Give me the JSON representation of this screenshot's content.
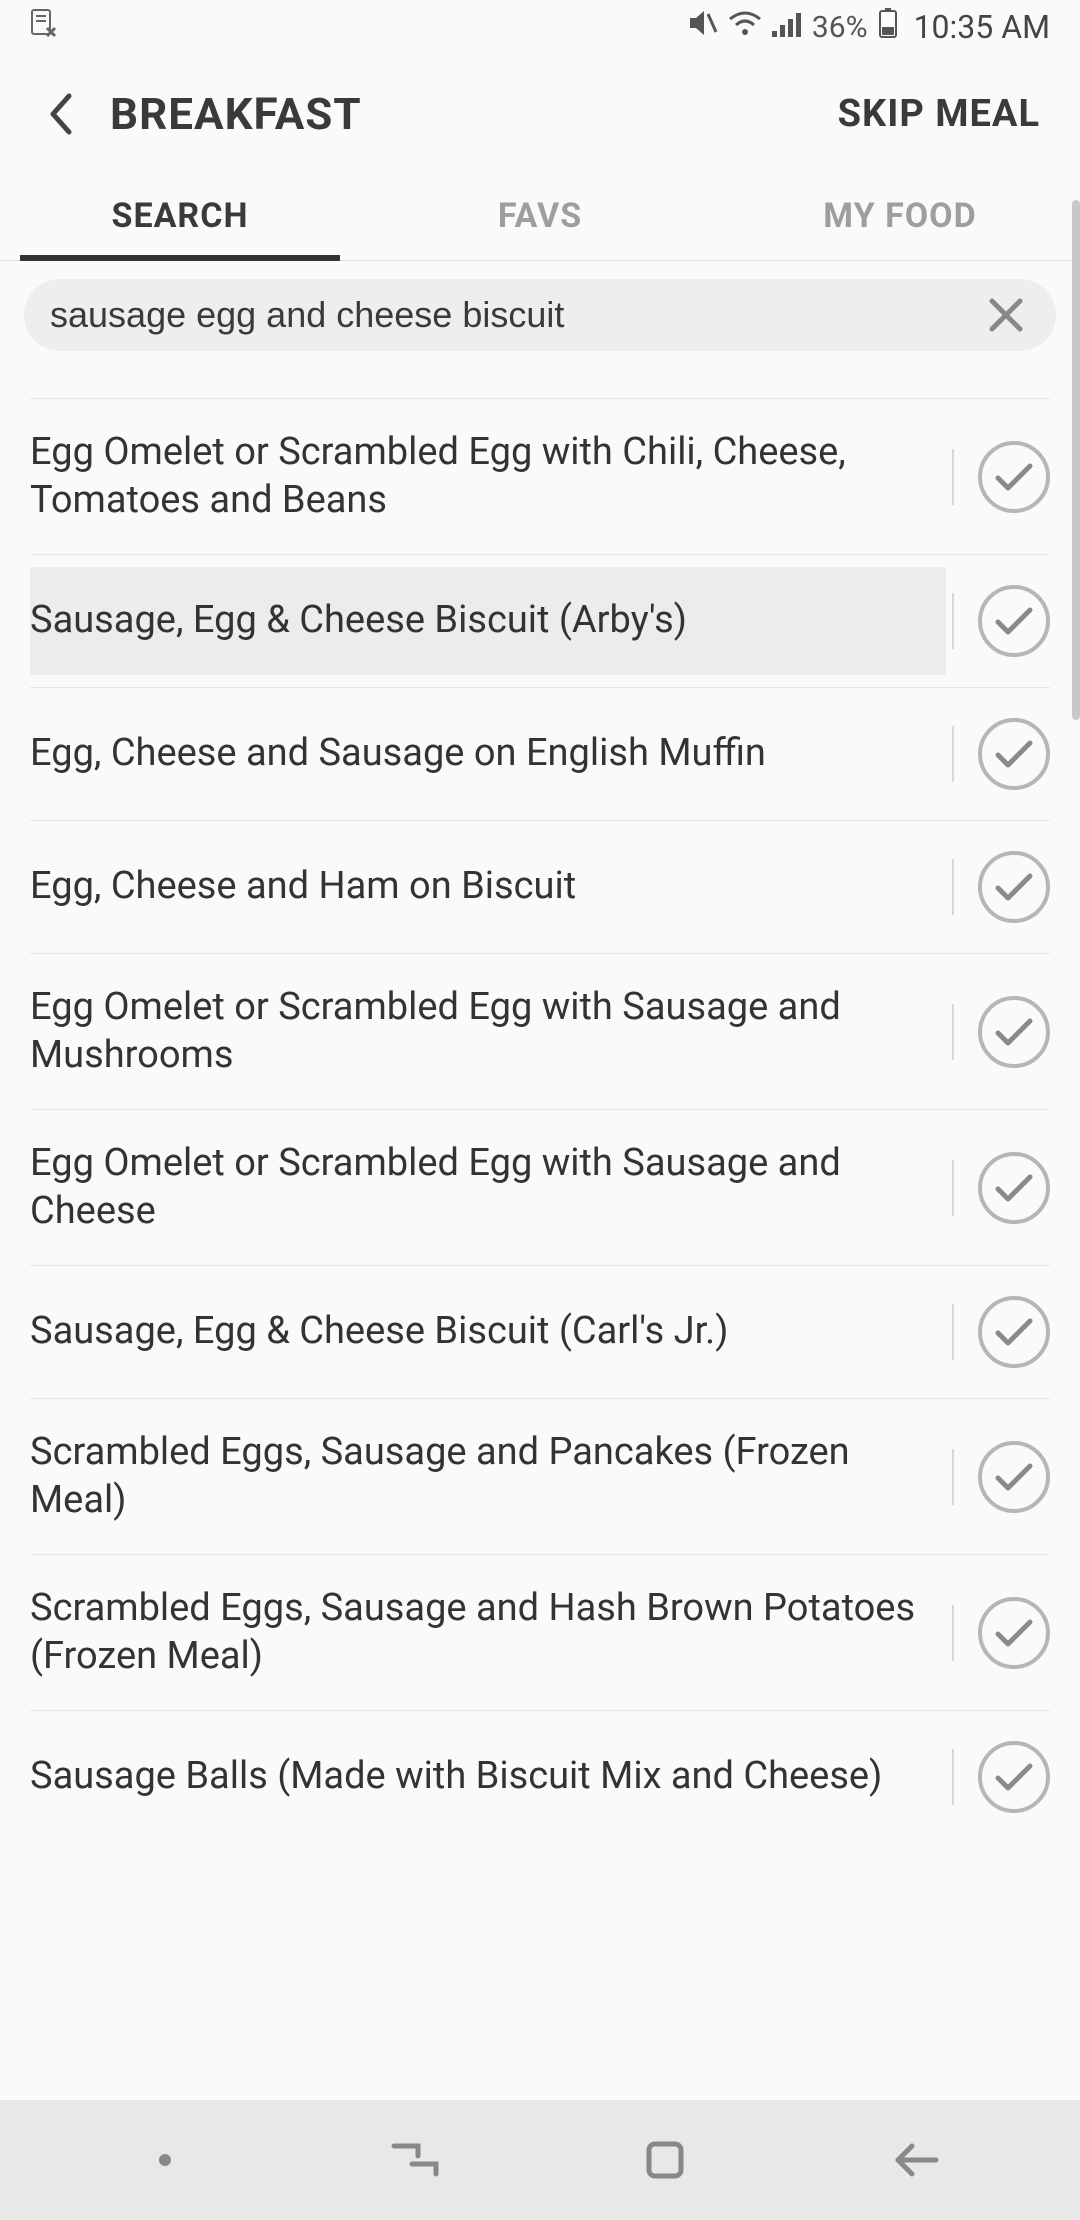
{
  "status": {
    "battery_pct": "36%",
    "time": "10:35 AM"
  },
  "header": {
    "title": "BREAKFAST",
    "skip_label": "SKIP MEAL"
  },
  "tabs": {
    "items": [
      {
        "label": "SEARCH",
        "active": true
      },
      {
        "label": "FAVS",
        "active": false
      },
      {
        "label": "MY FOOD",
        "active": false
      }
    ]
  },
  "search": {
    "value": "sausage egg and cheese biscuit"
  },
  "results": {
    "items": [
      {
        "label": "Egg Omelet or Scrambled Egg with Chili, Cheese, Tomatoes and Beans",
        "highlight": false
      },
      {
        "label": "Sausage, Egg & Cheese Biscuit (Arby's)",
        "highlight": true
      },
      {
        "label": "Egg, Cheese and Sausage on English Muffin",
        "highlight": false
      },
      {
        "label": "Egg, Cheese and Ham on Biscuit",
        "highlight": false
      },
      {
        "label": "Egg Omelet or Scrambled Egg with Sausage and Mushrooms",
        "highlight": false
      },
      {
        "label": "Egg Omelet or Scrambled Egg with Sausage and Cheese",
        "highlight": false
      },
      {
        "label": "Sausage, Egg & Cheese Biscuit (Carl's Jr.)",
        "highlight": false
      },
      {
        "label": "Scrambled Eggs, Sausage and Pancakes (Frozen Meal)",
        "highlight": false
      },
      {
        "label": "Scrambled Eggs, Sausage and Hash Brown Potatoes (Frozen Meal)",
        "highlight": false
      },
      {
        "label": "Sausage Balls (Made with Biscuit Mix and Cheese)",
        "highlight": false
      }
    ]
  }
}
